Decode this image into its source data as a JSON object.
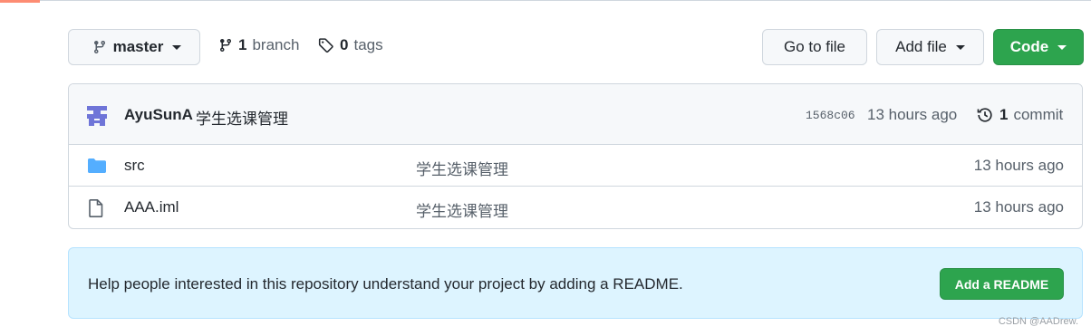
{
  "toolbar": {
    "branch_label": "master",
    "branches_count": "1",
    "branches_label": "branch",
    "tags_count": "0",
    "tags_label": "tags",
    "goto_file_label": "Go to file",
    "add_file_label": "Add file",
    "code_label": "Code"
  },
  "latest_commit": {
    "author": "AyuSunA",
    "message": "学生选课管理",
    "sha": "1568c06",
    "time": "13 hours ago",
    "commit_count": "1",
    "commit_label": "commit"
  },
  "files": [
    {
      "icon": "folder-icon",
      "name": "src",
      "message": "学生选课管理",
      "time": "13 hours ago"
    },
    {
      "icon": "file-icon",
      "name": "AAA.iml",
      "message": "学生选课管理",
      "time": "13 hours ago"
    }
  ],
  "readme_prompt": {
    "message": "Help people interested in this repository understand your project by adding a README.",
    "button_label": "Add a README"
  },
  "watermark": "CSDN @AADrew.",
  "colors": {
    "primary_green": "#2da44e",
    "folder_blue": "#54aeff",
    "banner_bg": "#ddf4ff",
    "avatar_purple": "#6f75d8"
  }
}
